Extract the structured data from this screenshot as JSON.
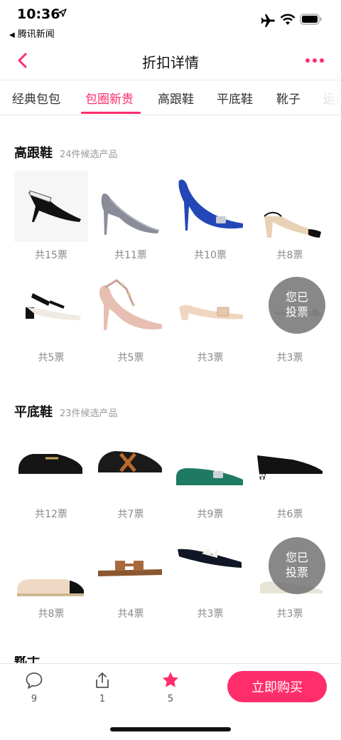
{
  "status_bar": {
    "time": "10:36",
    "back_app": "腾讯新闻",
    "icons": [
      "location-arrow-icon",
      "airplane-icon",
      "wifi-icon",
      "battery-icon"
    ]
  },
  "nav": {
    "title": "折扣详情",
    "back_icon": "chevron-left-icon",
    "more_icon": "more-dots-icon",
    "accent_color": "#ff2d6c"
  },
  "tabs": [
    {
      "label": "经典包包",
      "active": false
    },
    {
      "label": "包圈新贵",
      "active": true
    },
    {
      "label": "高跟鞋",
      "active": false
    },
    {
      "label": "平底鞋",
      "active": false
    },
    {
      "label": "靴子",
      "active": false
    },
    {
      "label": "运动",
      "active": false
    }
  ],
  "sections": [
    {
      "title": "高跟鞋",
      "subtitle": "24件候选产品",
      "products": [
        {
          "votes": "共15票",
          "voted": false
        },
        {
          "votes": "共11票",
          "voted": false
        },
        {
          "votes": "共10票",
          "voted": false
        },
        {
          "votes": "共8票",
          "voted": false
        },
        {
          "votes": "共5票",
          "voted": false
        },
        {
          "votes": "共5票",
          "voted": false
        },
        {
          "votes": "共3票",
          "voted": false
        },
        {
          "votes": "共3票",
          "voted": true
        }
      ]
    },
    {
      "title": "平底鞋",
      "subtitle": "23件候选产品",
      "products": [
        {
          "votes": "共12票",
          "voted": false
        },
        {
          "votes": "共7票",
          "voted": false
        },
        {
          "votes": "共9票",
          "voted": false
        },
        {
          "votes": "共6票",
          "voted": false
        },
        {
          "votes": "共8票",
          "voted": false
        },
        {
          "votes": "共4票",
          "voted": false
        },
        {
          "votes": "共3票",
          "voted": false
        },
        {
          "votes": "共3票",
          "voted": true
        }
      ]
    }
  ],
  "voted_badge": {
    "line1": "您已",
    "line2": "投票"
  },
  "next_section_title": "靴子",
  "bottom_bar": {
    "comments": {
      "icon": "comment-icon",
      "count": "9"
    },
    "share": {
      "icon": "share-icon",
      "count": "1"
    },
    "favorite": {
      "icon": "star-icon",
      "count": "5"
    },
    "buy_label": "立即购买"
  }
}
